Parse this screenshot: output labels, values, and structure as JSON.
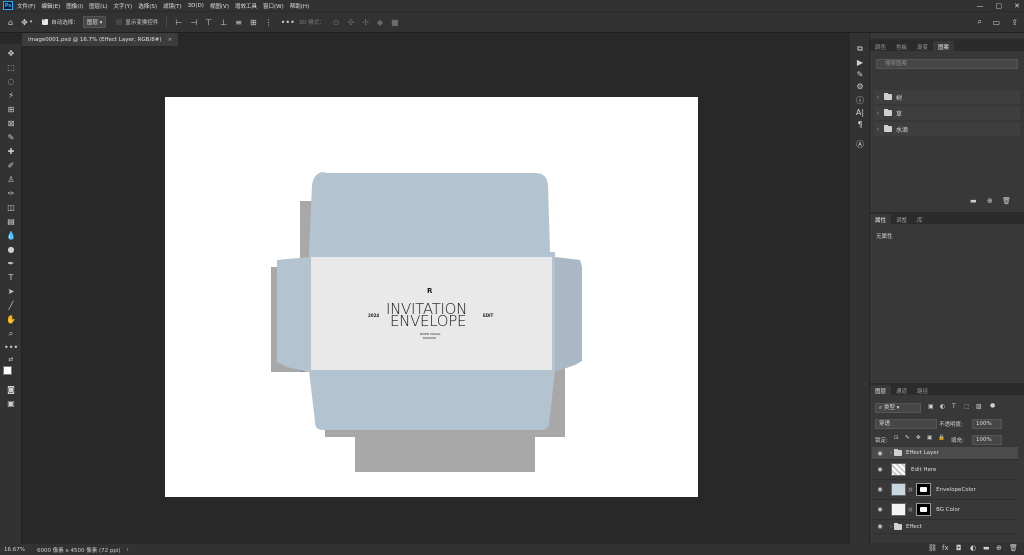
{
  "app": {
    "logo": "Ps",
    "menu": [
      "文件(F)",
      "编辑(E)",
      "图像(I)",
      "图层(L)",
      "文字(Y)",
      "选择(S)",
      "滤镜(T)",
      "3D(D)",
      "视图(V)",
      "增效工具",
      "窗口(W)",
      "帮助(H)"
    ],
    "window_controls": [
      "—",
      "▢",
      "✕"
    ]
  },
  "options_bar": {
    "auto_select_label": "自动选择：",
    "auto_select_value": "图层",
    "show_transform_label": "显示变换控件",
    "mode_3d_label": "3D 模式："
  },
  "document": {
    "tab_label": "Image0001.psd @ 16.7% (Effect Layer, RGB/8#)",
    "tab_close": "×"
  },
  "status": {
    "zoom": "16.67%",
    "size": "6000 像素 x 4500 像素 (72 ppi)",
    "arrow": "›"
  },
  "artwork": {
    "title_line1": "INVITATION",
    "title_line2": "ENVELOPE",
    "year": "2024",
    "edit": "EDIT",
    "logo_mark": "R",
    "tag_line1": "RIVER VISUAL",
    "tag_line2": "MOCKUP",
    "envelope_color": "#b3c3cf",
    "card_color": "#e9e9e9"
  },
  "libraries_panel": {
    "tabs": [
      "颜色",
      "色板",
      "渐变",
      "图案"
    ],
    "active_tab": 3,
    "search_placeholder": "搜索图案",
    "groups": [
      "树",
      "草",
      "水滴"
    ]
  },
  "properties_panel": {
    "tabs": [
      "属性",
      "调整",
      "库"
    ],
    "active_tab": 0,
    "empty_text": "无属性"
  },
  "layers_panel": {
    "tabs": [
      "图层",
      "通道",
      "路径"
    ],
    "active_tab": 0,
    "filter_label": "类型",
    "blend_mode": "穿透",
    "opacity_label": "不透明度:",
    "opacity_value": "100%",
    "lock_label": "锁定:",
    "fill_label": "填充:",
    "fill_value": "100%",
    "layers": [
      {
        "name": "Effect Layer",
        "type": "group",
        "selected": true
      },
      {
        "name": "Edit Here",
        "type": "smart"
      },
      {
        "name": "EnvelopeColor",
        "type": "adjust"
      },
      {
        "name": "BG Color",
        "type": "fill"
      },
      {
        "name": "Effect",
        "type": "group"
      }
    ]
  }
}
